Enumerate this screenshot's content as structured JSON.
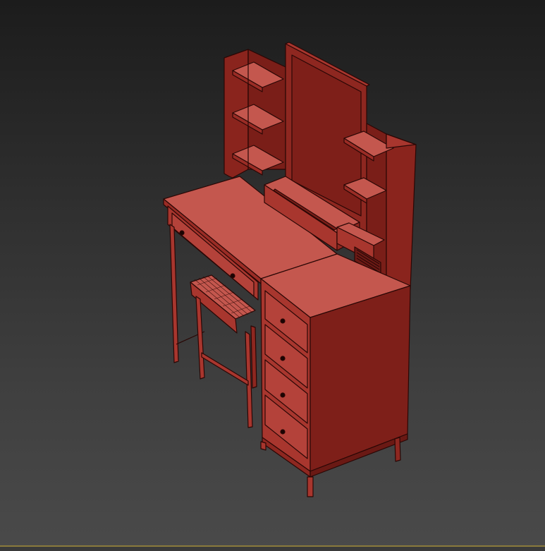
{
  "viewport": {
    "background_top": "#1c1c1c",
    "background_bottom": "#4a4a4a",
    "frame_line_color": "#8a7a3c"
  },
  "model": {
    "object": "vanity-table-with-mirror-and-stool",
    "shading": "wireframe-on-shaded",
    "color_light": "#c4574e",
    "color_mid": "#a8362e",
    "color_dark": "#7e1f19",
    "color_darker": "#6a1914",
    "edge_color": "#2a0705"
  }
}
